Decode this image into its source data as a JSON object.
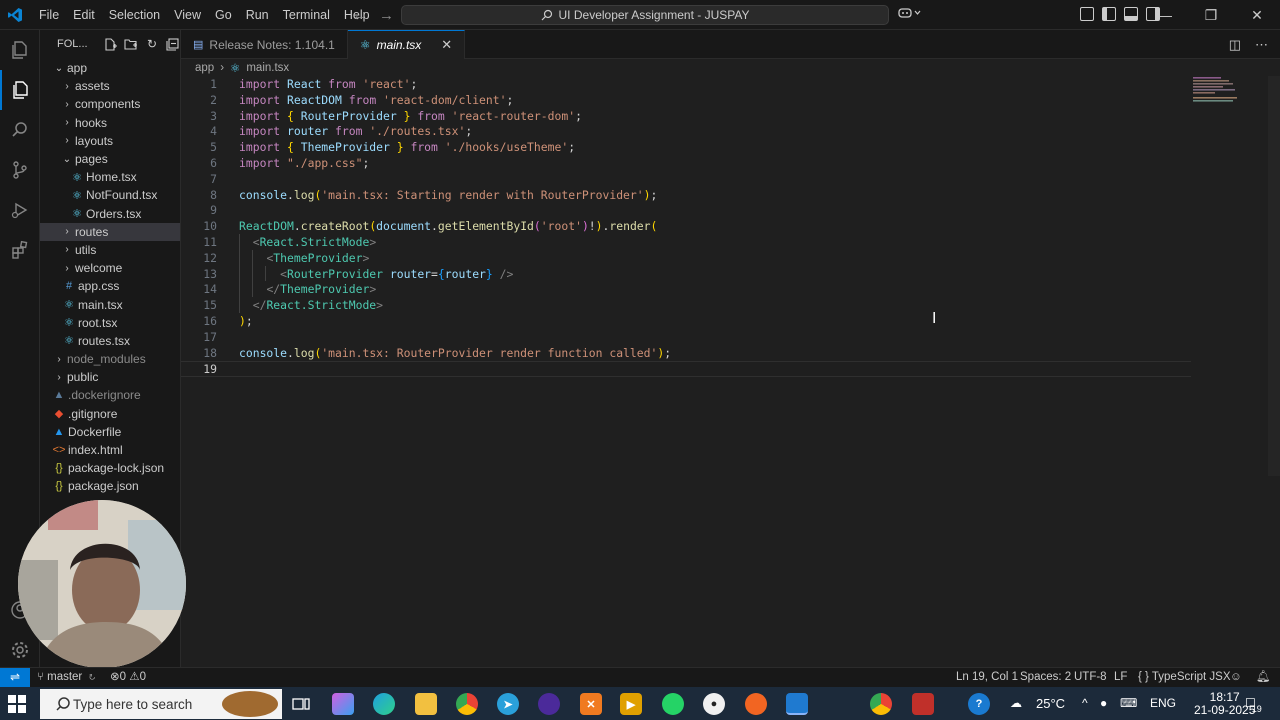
{
  "menu": [
    "File",
    "Edit",
    "Selection",
    "View",
    "Go",
    "Run",
    "Terminal",
    "Help"
  ],
  "command_center": "UI Developer Assignment - JUSPAY",
  "explorer": {
    "title": "FOL...",
    "tree": [
      {
        "label": "app",
        "kind": "folder-open",
        "depth": 0
      },
      {
        "label": "assets",
        "kind": "folder",
        "depth": 1
      },
      {
        "label": "components",
        "kind": "folder",
        "depth": 1
      },
      {
        "label": "hooks",
        "kind": "folder",
        "depth": 1
      },
      {
        "label": "layouts",
        "kind": "folder",
        "depth": 1
      },
      {
        "label": "pages",
        "kind": "folder-open",
        "depth": 1
      },
      {
        "label": "Home.tsx",
        "kind": "tsx",
        "depth": 2
      },
      {
        "label": "NotFound.tsx",
        "kind": "tsx",
        "depth": 2
      },
      {
        "label": "Orders.tsx",
        "kind": "tsx",
        "depth": 2
      },
      {
        "label": "routes",
        "kind": "folder",
        "depth": 1,
        "selected": true
      },
      {
        "label": "utils",
        "kind": "folder",
        "depth": 1
      },
      {
        "label": "welcome",
        "kind": "folder",
        "depth": 1
      },
      {
        "label": "app.css",
        "kind": "css",
        "depth": 1
      },
      {
        "label": "main.tsx",
        "kind": "tsx",
        "depth": 1
      },
      {
        "label": "root.tsx",
        "kind": "tsx",
        "depth": 1
      },
      {
        "label": "routes.tsx",
        "kind": "tsx",
        "depth": 1
      },
      {
        "label": "node_modules",
        "kind": "folder-dim",
        "depth": 0
      },
      {
        "label": "public",
        "kind": "folder",
        "depth": 0
      },
      {
        "label": ".dockerignore",
        "kind": "docker-dim",
        "depth": 0
      },
      {
        "label": ".gitignore",
        "kind": "git",
        "depth": 0
      },
      {
        "label": "Dockerfile",
        "kind": "docker",
        "depth": 0
      },
      {
        "label": "index.html",
        "kind": "html",
        "depth": 0
      },
      {
        "label": "package-lock.json",
        "kind": "json",
        "depth": 0
      },
      {
        "label": "package.json",
        "kind": "json",
        "depth": 0
      }
    ]
  },
  "tabs": [
    {
      "label": "Release Notes: 1.104.1",
      "active": false
    },
    {
      "label": "main.tsx",
      "active": true
    }
  ],
  "breadcrumb": {
    "folder": "app",
    "file": "main.tsx"
  },
  "editor": {
    "current_line": 19,
    "lines": [
      {
        "n": "1",
        "tokens": [
          [
            "kw",
            "import "
          ],
          [
            "id",
            "React "
          ],
          [
            "kw",
            "from "
          ],
          [
            "st",
            "'react'"
          ],
          [
            "pn",
            ";"
          ]
        ]
      },
      {
        "n": "2",
        "tokens": [
          [
            "kw",
            "import "
          ],
          [
            "id",
            "ReactDOM "
          ],
          [
            "kw",
            "from "
          ],
          [
            "st",
            "'react-dom/client'"
          ],
          [
            "pn",
            ";"
          ]
        ]
      },
      {
        "n": "3",
        "tokens": [
          [
            "kw",
            "import "
          ],
          [
            "br1",
            "{ "
          ],
          [
            "id",
            "RouterProvider "
          ],
          [
            "br1",
            "} "
          ],
          [
            "kw",
            "from "
          ],
          [
            "st",
            "'react-router-dom'"
          ],
          [
            "pn",
            ";"
          ]
        ]
      },
      {
        "n": "4",
        "tokens": [
          [
            "kw",
            "import "
          ],
          [
            "id",
            "router "
          ],
          [
            "kw",
            "from "
          ],
          [
            "st",
            "'./routes.tsx'"
          ],
          [
            "pn",
            ";"
          ]
        ]
      },
      {
        "n": "5",
        "tokens": [
          [
            "kw",
            "import "
          ],
          [
            "br1",
            "{ "
          ],
          [
            "id",
            "ThemeProvider "
          ],
          [
            "br1",
            "} "
          ],
          [
            "kw",
            "from "
          ],
          [
            "st",
            "'./hooks/useTheme'"
          ],
          [
            "pn",
            ";"
          ]
        ]
      },
      {
        "n": "6",
        "tokens": [
          [
            "kw",
            "import "
          ],
          [
            "st",
            "\"./app.css\""
          ],
          [
            "pn",
            ";"
          ]
        ]
      },
      {
        "n": "7",
        "tokens": []
      },
      {
        "n": "8",
        "tokens": [
          [
            "id",
            "console"
          ],
          [
            "pn",
            "."
          ],
          [
            "fn",
            "log"
          ],
          [
            "br1",
            "("
          ],
          [
            "st",
            "'main.tsx: Starting render with RouterProvider'"
          ],
          [
            "br1",
            ")"
          ],
          [
            "pn",
            ";"
          ]
        ]
      },
      {
        "n": "9",
        "tokens": []
      },
      {
        "n": "10",
        "tokens": [
          [
            "ty",
            "ReactDOM"
          ],
          [
            "pn",
            "."
          ],
          [
            "fn",
            "createRoot"
          ],
          [
            "br1",
            "("
          ],
          [
            "id",
            "document"
          ],
          [
            "pn",
            "."
          ],
          [
            "fn",
            "getElementById"
          ],
          [
            "br2",
            "("
          ],
          [
            "st",
            "'root'"
          ],
          [
            "br2",
            ")"
          ],
          [
            "pn",
            "!"
          ],
          [
            "br1",
            ")"
          ],
          [
            "pn",
            "."
          ],
          [
            "fn",
            "render"
          ],
          [
            "br1",
            "("
          ]
        ]
      },
      {
        "n": "11",
        "tokens": [
          [
            "pn",
            "  "
          ],
          [
            "ang",
            "<"
          ],
          [
            "tag",
            "React.StrictMode"
          ],
          [
            "ang",
            ">"
          ]
        ]
      },
      {
        "n": "12",
        "tokens": [
          [
            "pn",
            "    "
          ],
          [
            "ang",
            "<"
          ],
          [
            "tag",
            "ThemeProvider"
          ],
          [
            "ang",
            ">"
          ]
        ]
      },
      {
        "n": "13",
        "tokens": [
          [
            "pn",
            "      "
          ],
          [
            "ang",
            "<"
          ],
          [
            "tag",
            "RouterProvider "
          ],
          [
            "id",
            "router"
          ],
          [
            "pn",
            "="
          ],
          [
            "br3",
            "{"
          ],
          [
            "id",
            "router"
          ],
          [
            "br3",
            "}"
          ],
          [
            "ang",
            " />"
          ]
        ]
      },
      {
        "n": "14",
        "tokens": [
          [
            "pn",
            "    "
          ],
          [
            "ang",
            "</"
          ],
          [
            "tag",
            "ThemeProvider"
          ],
          [
            "ang",
            ">"
          ]
        ]
      },
      {
        "n": "15",
        "tokens": [
          [
            "pn",
            "  "
          ],
          [
            "ang",
            "</"
          ],
          [
            "tag",
            "React.StrictMode"
          ],
          [
            "ang",
            ">"
          ]
        ]
      },
      {
        "n": "16",
        "tokens": [
          [
            "br1",
            ")"
          ],
          [
            "pn",
            ";"
          ]
        ]
      },
      {
        "n": "17",
        "tokens": []
      },
      {
        "n": "18",
        "tokens": [
          [
            "id",
            "console"
          ],
          [
            "pn",
            "."
          ],
          [
            "fn",
            "log"
          ],
          [
            "br1",
            "("
          ],
          [
            "st",
            "'main.tsx: RouterProvider render function called'"
          ],
          [
            "br1",
            ")"
          ],
          [
            "pn",
            ";"
          ]
        ]
      },
      {
        "n": "19",
        "tokens": []
      }
    ]
  },
  "status": {
    "branch": "master",
    "problems": "0",
    "warnings": "0",
    "position": "Ln 19, Col 1",
    "spaces": "Spaces: 2",
    "encoding": "UTF-8",
    "eol": "LF",
    "language": "TypeScript JSX"
  },
  "taskbar": {
    "search_placeholder": "Type here to search",
    "temperature": "25°C",
    "language": "ENG",
    "time": "18:17",
    "date": "21-09-2025",
    "notification_count": "19"
  },
  "colors": {
    "accent": "#0078d4",
    "editor_bg": "#1f1f1f",
    "sidebar_bg": "#181818"
  }
}
